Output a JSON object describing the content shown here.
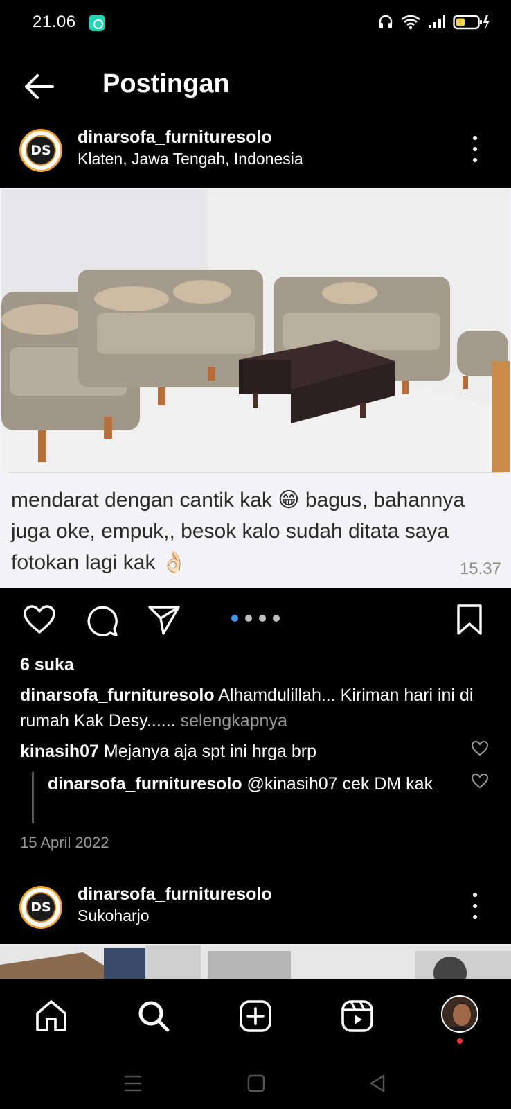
{
  "status": {
    "time": "21.06"
  },
  "topbar": {
    "title": "Postingan"
  },
  "post1": {
    "username": "dinarsofa_furnituresolo",
    "location": "Klaten, Jawa Tengah, Indonesia",
    "avatar_text": "DS",
    "photo_caption": "mendarat dengan cantik kak 😁 bagus, bahannya juga oke, empuk,, besok kalo sudah ditata saya fotokan lagi kak 👌🏻",
    "photo_time": "15.37",
    "likes": "6 suka",
    "caption_user": "dinarsofa_furnituresolo",
    "caption_text": "Alhamdulillah... Kiriman hari ini di rumah Kak Desy......",
    "more_label": "selengkapnya",
    "comments": [
      {
        "user": "kinasih07",
        "text": "Mejanya aja spt ini hrga brp"
      },
      {
        "user": "dinarsofa_furnituresolo",
        "text": "@kinasih07 cek DM kak"
      }
    ],
    "date": "15 April 2022"
  },
  "post2": {
    "username": "dinarsofa_furnituresolo",
    "location": "Sukoharjo",
    "avatar_text": "DS"
  },
  "icons": {
    "back": "arrow-left-icon",
    "like": "heart-icon",
    "comment": "comment-icon",
    "share": "send-icon",
    "save": "bookmark-icon",
    "home": "home-icon",
    "search": "search-icon",
    "create": "plus-square-icon",
    "reels": "reels-icon"
  },
  "colors": {
    "carousel_active": "#3897f0",
    "avatar_ring": "#f2a53a",
    "notification": "#ff3040"
  }
}
